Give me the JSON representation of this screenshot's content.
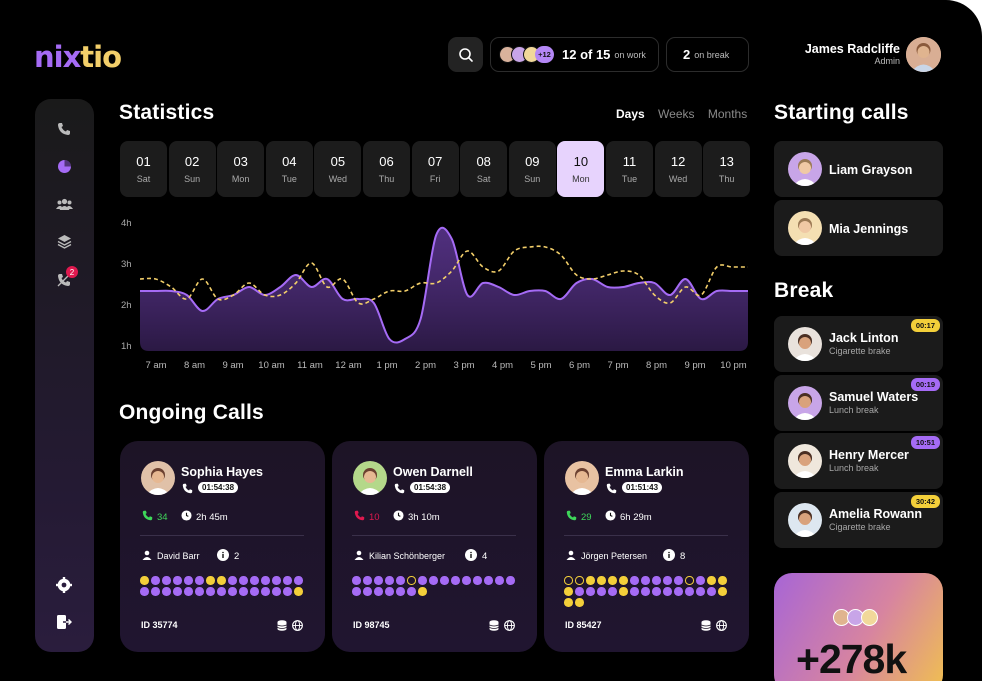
{
  "brand": {
    "logo_a": "nix",
    "logo_b": "tio"
  },
  "header": {
    "work_count": "12 of 15",
    "work_label": "on work",
    "more_count": "+12",
    "break_count": "2",
    "break_label": "on break",
    "user_name": "James Radcliffe",
    "user_role": "Admin"
  },
  "sidebar": {
    "items": [
      "phone-icon",
      "pie-chart-icon",
      "team-icon",
      "layers-icon",
      "missed-call-icon"
    ],
    "missed_badge": "2",
    "bottom": [
      "settings-icon",
      "logout-icon"
    ]
  },
  "statistics": {
    "title": "Statistics",
    "tabs": [
      "Days",
      "Weeks",
      "Months"
    ],
    "active_tab": "Days",
    "days": [
      {
        "num": "01",
        "wd": "Sat"
      },
      {
        "num": "02",
        "wd": "Sun"
      },
      {
        "num": "03",
        "wd": "Mon"
      },
      {
        "num": "04",
        "wd": "Tue"
      },
      {
        "num": "05",
        "wd": "Wed"
      },
      {
        "num": "06",
        "wd": "Thu"
      },
      {
        "num": "07",
        "wd": "Fri"
      },
      {
        "num": "08",
        "wd": "Sat"
      },
      {
        "num": "09",
        "wd": "Sun"
      },
      {
        "num": "10",
        "wd": "Mon"
      },
      {
        "num": "11",
        "wd": "Tue"
      },
      {
        "num": "12",
        "wd": "Wed"
      },
      {
        "num": "13",
        "wd": "Thu"
      }
    ],
    "selected_day": "10"
  },
  "chart_data": {
    "type": "area",
    "ylabels": [
      "4h",
      "3h",
      "2h",
      "1h"
    ],
    "ylim": [
      1,
      4.2
    ],
    "categories": [
      "7 am",
      "8 am",
      "9 am",
      "10 am",
      "11 am",
      "12 am",
      "1 pm",
      "2 pm",
      "3 pm",
      "4 pm",
      "5 pm",
      "6 pm",
      "7 pm",
      "8 pm",
      "9 pm",
      "10 pm"
    ],
    "series": [
      {
        "style": "solid-area",
        "color": "#a56bf5",
        "x": [
          6.8,
          7.2,
          7.6,
          8.0,
          8.4,
          8.8,
          9.2,
          9.6,
          10.0,
          10.4,
          10.8,
          11.2,
          11.6,
          12.0,
          12.4,
          12.8,
          13.2,
          13.6,
          14.0,
          14.4,
          14.8,
          15.2,
          15.6,
          16.0,
          16.4,
          16.8,
          17.2,
          17.6,
          18.0,
          18.4,
          18.8,
          19.2,
          19.6,
          20.0,
          20.4,
          20.8,
          21.2,
          21.6,
          22.0,
          22.4
        ],
        "y": [
          2.5,
          2.5,
          2.5,
          2.4,
          2.0,
          2.3,
          2.4,
          2.6,
          2.4,
          2.6,
          2.9,
          2.6,
          2.8,
          2.3,
          2.3,
          2.2,
          1.3,
          1.3,
          1.8,
          3.9,
          3.8,
          2.4,
          2.7,
          2.6,
          2.4,
          2.5,
          2.5,
          2.3,
          2.7,
          2.8,
          2.6,
          2.6,
          2.7,
          2.7,
          2.4,
          2.8,
          2.3,
          2.5,
          2.5,
          2.5
        ]
      },
      {
        "style": "dashed-line",
        "color": "#f3cf6a",
        "x": [
          6.8,
          7.2,
          7.6,
          8.0,
          8.4,
          8.8,
          9.2,
          9.6,
          10.0,
          10.4,
          10.8,
          11.2,
          11.6,
          12.0,
          12.4,
          12.8,
          13.2,
          13.6,
          14.0,
          14.4,
          14.8,
          15.2,
          15.6,
          16.0,
          16.4,
          16.8,
          17.2,
          17.6,
          18.0,
          18.4,
          18.8,
          19.2,
          19.6,
          20.0,
          20.4,
          20.8,
          21.2,
          21.6,
          22.0,
          22.4
        ],
        "y": [
          2.8,
          2.8,
          2.6,
          2.3,
          2.8,
          2.3,
          2.4,
          2.7,
          2.4,
          2.4,
          2.7,
          3.2,
          2.6,
          2.8,
          2.2,
          2.3,
          2.5,
          2.5,
          2.7,
          2.7,
          3.0,
          3.5,
          3.1,
          3.0,
          3.5,
          3.6,
          3.6,
          3.4,
          2.9,
          2.8,
          2.9,
          3.0,
          2.9,
          2.4,
          2.2,
          2.6,
          2.4,
          3.1,
          3.1,
          3.1
        ]
      }
    ],
    "grid": false,
    "legend": "none"
  },
  "ongoing": {
    "title": "Ongoing Calls",
    "calls": [
      {
        "name": "Sophia Hayes",
        "time": "01:54:38",
        "count": "34",
        "count_color": "#3ed65a",
        "duration": "2h 45m",
        "agent": "David Barr",
        "info": "2",
        "id": "ID 35774",
        "dots": "ypppppyypppppppppppppppppppppy"
      },
      {
        "name": "Owen Darnell",
        "time": "01:54:38",
        "count": "10",
        "count_color": "#e0194f",
        "duration": "3h 10m",
        "agent": "Kilian Schönberger",
        "info": "4",
        "id": "ID 98745",
        "dots": "pppppopppppppppppppppy"
      },
      {
        "name": "Emma Larkin",
        "time": "01:51:43",
        "count": "29",
        "count_color": "#3ed65a",
        "duration": "6h 29m",
        "agent": "Jörgen Petersen",
        "info": "8",
        "id": "ID 85427",
        "dots": "ooyyyypppppopyyyppppyppppppppyyy"
      }
    ]
  },
  "starting": {
    "title": "Starting calls",
    "people": [
      {
        "name": "Liam Grayson"
      },
      {
        "name": "Mia Jennings"
      }
    ]
  },
  "break": {
    "title": "Break",
    "people": [
      {
        "name": "Jack Linton",
        "reason": "Cigarette brake",
        "time": "00:17",
        "tag": "#f3cf3a"
      },
      {
        "name": "Samuel Waters",
        "reason": "Lunch break",
        "time": "00:19",
        "tag": "#a56bf5"
      },
      {
        "name": "Henry Mercer",
        "reason": "Lunch break",
        "time": "10:51",
        "tag": "#a56bf5"
      },
      {
        "name": "Amelia Rowann",
        "reason": "Cigarette brake",
        "time": "30:42",
        "tag": "#f3cf3a"
      }
    ]
  },
  "promo": {
    "value": "+278k"
  }
}
